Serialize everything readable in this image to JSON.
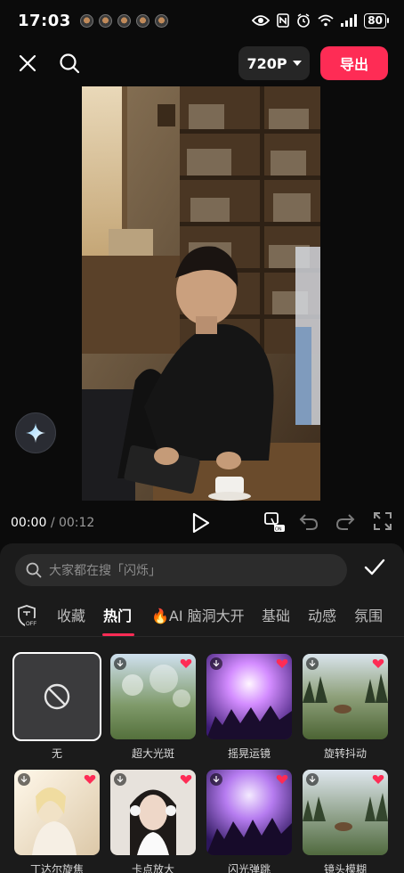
{
  "status_bar": {
    "time": "17:03",
    "battery": "80",
    "notification_icons": [
      "app-icon",
      "app-icon",
      "app-icon",
      "app-icon",
      "app-icon"
    ],
    "system_icons": [
      "eye-icon",
      "nfc-icon",
      "alarm-icon",
      "wifi-icon",
      "signal-icon",
      "battery-icon"
    ]
  },
  "toolbar": {
    "close_icon": "close-icon",
    "search_icon": "search-icon",
    "resolution": "720P",
    "export_label": "导出"
  },
  "playback": {
    "current_time": "00:00",
    "separator": "/",
    "total_time": "00:12",
    "icons": [
      "play-icon",
      "keyframe-on-icon",
      "undo-icon",
      "redo-icon",
      "fullscreen-icon"
    ]
  },
  "effects_panel": {
    "search_placeholder": "大家都在搜「闪烁」",
    "tabs": [
      "收藏",
      "热门",
      "AI 脑洞大开",
      "基础",
      "动感",
      "氛围"
    ],
    "active_tab": "热门",
    "items": [
      {
        "label": "无",
        "selected": true
      },
      {
        "label": "超大光斑"
      },
      {
        "label": "摇晃运镜"
      },
      {
        "label": "旋转抖动"
      },
      {
        "label": "丁达尔旋焦"
      },
      {
        "label": "卡点放大"
      },
      {
        "label": "闪光弹跳"
      },
      {
        "label": "镜头模糊"
      }
    ]
  },
  "colors": {
    "accent": "#fe2c55",
    "background": "#0b0b0b",
    "panel": "#1b1b1b"
  }
}
